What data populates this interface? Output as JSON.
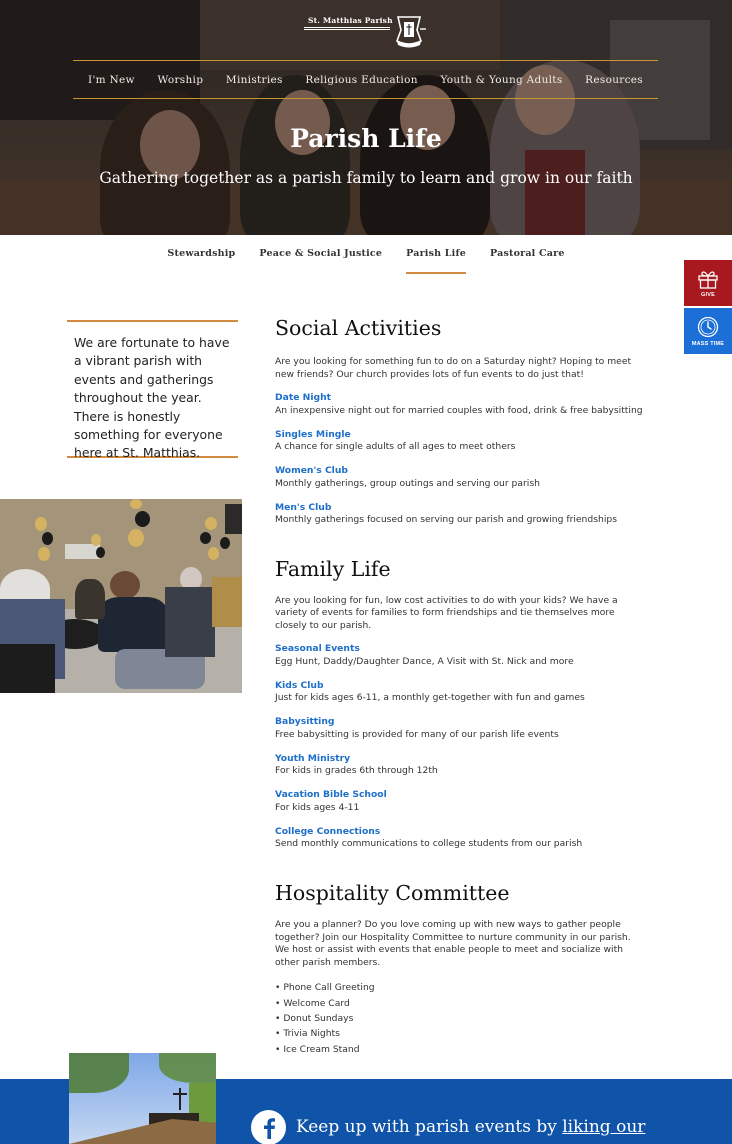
{
  "header": {
    "logo_text": "St. Matthias Parish",
    "nav": [
      {
        "label": "I'm New"
      },
      {
        "label": "Worship"
      },
      {
        "label": "Ministries"
      },
      {
        "label": "Religious Education"
      },
      {
        "label": "Youth & Young Adults"
      },
      {
        "label": "Resources"
      }
    ]
  },
  "hero": {
    "title": "Parish Life",
    "subtitle": "Gathering together as a parish family to learn and grow in our faith"
  },
  "subnav": {
    "items": [
      {
        "label": "Stewardship",
        "active": false
      },
      {
        "label": "Peace & Social Justice",
        "active": false
      },
      {
        "label": "Parish Life",
        "active": true
      },
      {
        "label": "Pastoral Care",
        "active": false
      }
    ]
  },
  "floating": {
    "give_label": "GIVE",
    "mass_label": "MASS TIME"
  },
  "callout": {
    "text": "We are fortunate to have a vibrant parish with events and gatherings throughout the year. There is honestly something for everyone here at St. Matthias."
  },
  "sections": {
    "social": {
      "heading": "Social Activities",
      "intro": "Are you looking for something fun to do on a Saturday night? Hoping to meet new friends? Our church provides lots of fun events to do just that!",
      "items": [
        {
          "title": "Date Night",
          "desc": "An inexpensive night out for married couples with food, drink & free babysitting"
        },
        {
          "title": "Singles Mingle",
          "desc": "A chance for single adults of all ages to meet others"
        },
        {
          "title": "Women's Club",
          "desc": "Monthly gatherings, group outings and serving our parish"
        },
        {
          "title": "Men's Club",
          "desc": "Monthly gatherings focused on serving our parish and growing friendships"
        }
      ]
    },
    "family": {
      "heading": "Family Life",
      "intro": "Are you looking for fun, low cost activities to do with your kids? We have a variety of events for families to form friendships and tie themselves more closely to our parish.",
      "items": [
        {
          "title": "Seasonal Events",
          "desc": "Egg Hunt, Daddy/Daughter Dance, A Visit with St. Nick and more"
        },
        {
          "title": "Kids Club",
          "desc": "Just for kids ages 6-11, a monthly get-together with fun and games"
        },
        {
          "title": "Babysitting",
          "desc": "Free babysitting is provided for many of our parish life events"
        },
        {
          "title": "Youth Ministry",
          "desc": "For kids in grades 6th through 12th"
        },
        {
          "title": "Vacation Bible School",
          "desc": "For kids ages 4-11"
        },
        {
          "title": "College Connections",
          "desc": "Send monthly communications to college students from our parish"
        }
      ]
    },
    "hospitality": {
      "heading": "Hospitality Committee",
      "intro": "Are you a planner? Do you love coming up with new ways to gather people together? Join our Hospitality Committee to nurture community in our parish. We host or assist with events that enable people to meet and socialize with other parish members.",
      "bullets": [
        "• Phone Call Greeting",
        "• Welcome Card",
        "• Donut Sundays",
        "• Trivia Nights",
        "• Ice Cream Stand"
      ]
    }
  },
  "footer_banner": {
    "text": "Keep up with parish events by ",
    "link": "liking our"
  },
  "colors": {
    "accent_orange": "#d38a3f",
    "nav_gold": "#c8962e",
    "link_blue": "#1e6fc9",
    "give_red": "#a8191f",
    "mass_blue": "#1c6fd6",
    "banner_blue": "#0f54a8"
  }
}
